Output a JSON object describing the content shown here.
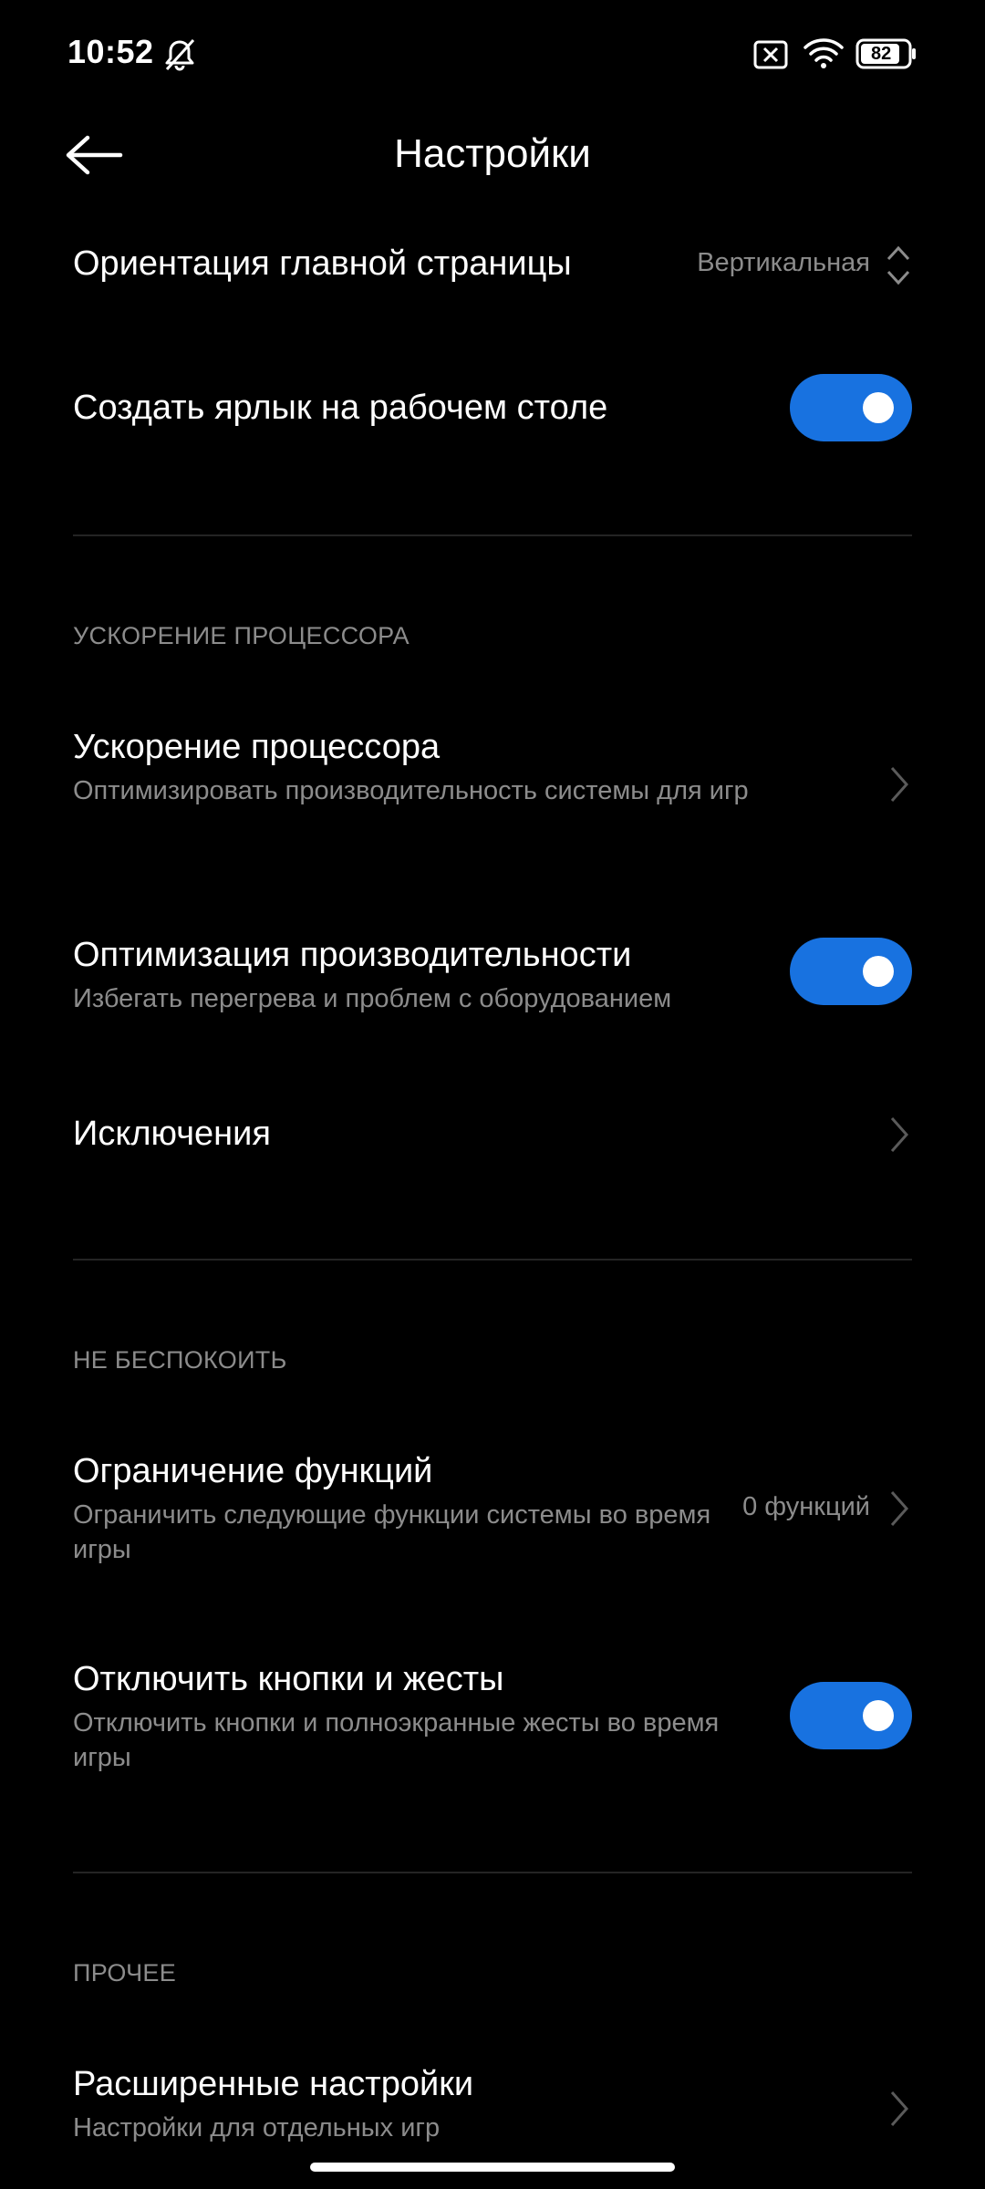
{
  "status_bar": {
    "time": "10:52",
    "battery": "82",
    "icons": [
      "mute-alarm-icon",
      "sim-disabled-icon",
      "wifi-icon",
      "battery-icon"
    ]
  },
  "header": {
    "title": "Настройки",
    "back_icon": "arrow-left-icon"
  },
  "rows": {
    "orientation": {
      "title": "Ориентация главной страницы",
      "value": "Вертикальная"
    },
    "shortcut": {
      "title": "Создать ярлык на рабочем столе",
      "enabled": true
    },
    "cpu_boost": {
      "title": "Ускорение процессора",
      "subtitle": "Оптимизировать производительность системы для игр"
    },
    "performance": {
      "title": "Оптимизация производительности",
      "subtitle": "Избегать перегрева и проблем с оборудованием",
      "enabled": true
    },
    "exceptions": {
      "title": "Исключения"
    },
    "restrictions": {
      "title": "Ограничение функций",
      "subtitle": "Ограничить следующие функции системы во время игры",
      "value": "0 функций"
    },
    "disable_buttons": {
      "title": "Отключить кнопки и жесты",
      "subtitle": "Отключить кнопки и полноэкранные жесты во время игры",
      "enabled": true
    },
    "advanced": {
      "title": "Расширенные настройки",
      "subtitle": "Настройки для отдельных игр"
    }
  },
  "sections": {
    "cpu": "УСКОРЕНИЕ ПРОЦЕССОРА",
    "dnd": "НЕ БЕСПОКОИТЬ",
    "other": "ПРОЧЕЕ"
  },
  "colors": {
    "background": "#000000",
    "accent": "#1872e0",
    "secondary_text": "#8c8c8c",
    "divider": "#242424"
  }
}
